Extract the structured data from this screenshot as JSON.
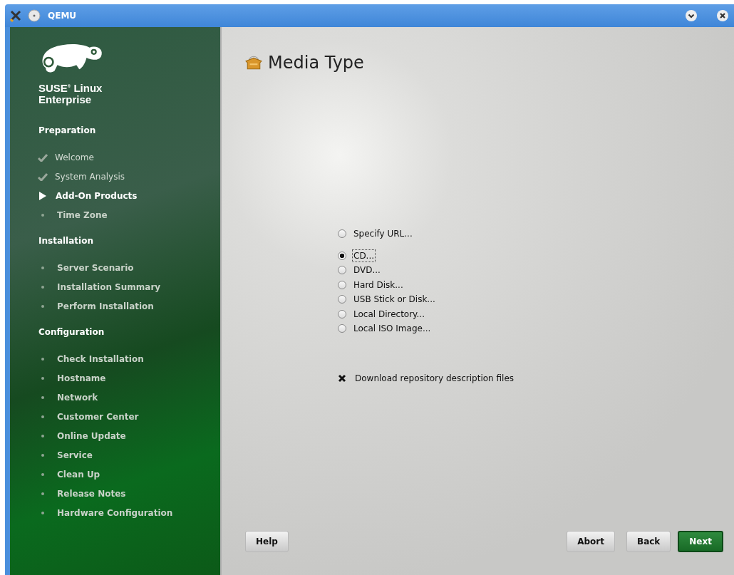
{
  "window": {
    "title": "QEMU"
  },
  "sidebar": {
    "brand": {
      "line1": "SUSE",
      "mark": "®",
      "line1b": "Linux",
      "line2": "Enterprise"
    },
    "sections": [
      {
        "title": "Preparation",
        "steps": [
          {
            "label": "Welcome",
            "kind": "done",
            "selected": false
          },
          {
            "label": "System Analysis",
            "kind": "done",
            "selected": false
          },
          {
            "label": "Add-On Products",
            "kind": "current",
            "selected": true
          },
          {
            "label": "Time Zone",
            "kind": "pending",
            "selected": false
          }
        ]
      },
      {
        "title": "Installation",
        "steps": [
          {
            "label": "Server Scenario",
            "kind": "pending",
            "selected": false
          },
          {
            "label": "Installation Summary",
            "kind": "pending",
            "selected": false
          },
          {
            "label": "Perform Installation",
            "kind": "pending",
            "selected": false
          }
        ]
      },
      {
        "title": "Configuration",
        "steps": [
          {
            "label": "Check Installation",
            "kind": "pending",
            "selected": false
          },
          {
            "label": "Hostname",
            "kind": "pending",
            "selected": false
          },
          {
            "label": "Network",
            "kind": "pending",
            "selected": false
          },
          {
            "label": "Customer Center",
            "kind": "pending",
            "selected": false
          },
          {
            "label": "Online Update",
            "kind": "pending",
            "selected": false
          },
          {
            "label": "Service",
            "kind": "pending",
            "selected": false
          },
          {
            "label": "Clean Up",
            "kind": "pending",
            "selected": false
          },
          {
            "label": "Release Notes",
            "kind": "pending",
            "selected": false
          },
          {
            "label": "Hardware Configuration",
            "kind": "pending",
            "selected": false
          }
        ]
      }
    ]
  },
  "page": {
    "title": "Media Type",
    "option_groups": [
      [
        {
          "label": "Specify URL...",
          "selected": false
        }
      ],
      [
        {
          "label": "CD...",
          "selected": true
        },
        {
          "label": "DVD...",
          "selected": false
        },
        {
          "label": "Hard Disk...",
          "selected": false
        },
        {
          "label": "USB Stick or Disk...",
          "selected": false
        },
        {
          "label": "Local Directory...",
          "selected": false
        },
        {
          "label": "Local ISO Image...",
          "selected": false
        }
      ]
    ],
    "download_checkbox": {
      "label": "Download repository description files",
      "checked": true
    }
  },
  "buttons": [
    {
      "label": "Help",
      "kind": "normal"
    },
    {
      "kind": "spacer"
    },
    {
      "label": "Abort",
      "kind": "normal"
    },
    {
      "label": "Back",
      "kind": "normal"
    },
    {
      "label": "Next",
      "kind": "primary"
    }
  ]
}
